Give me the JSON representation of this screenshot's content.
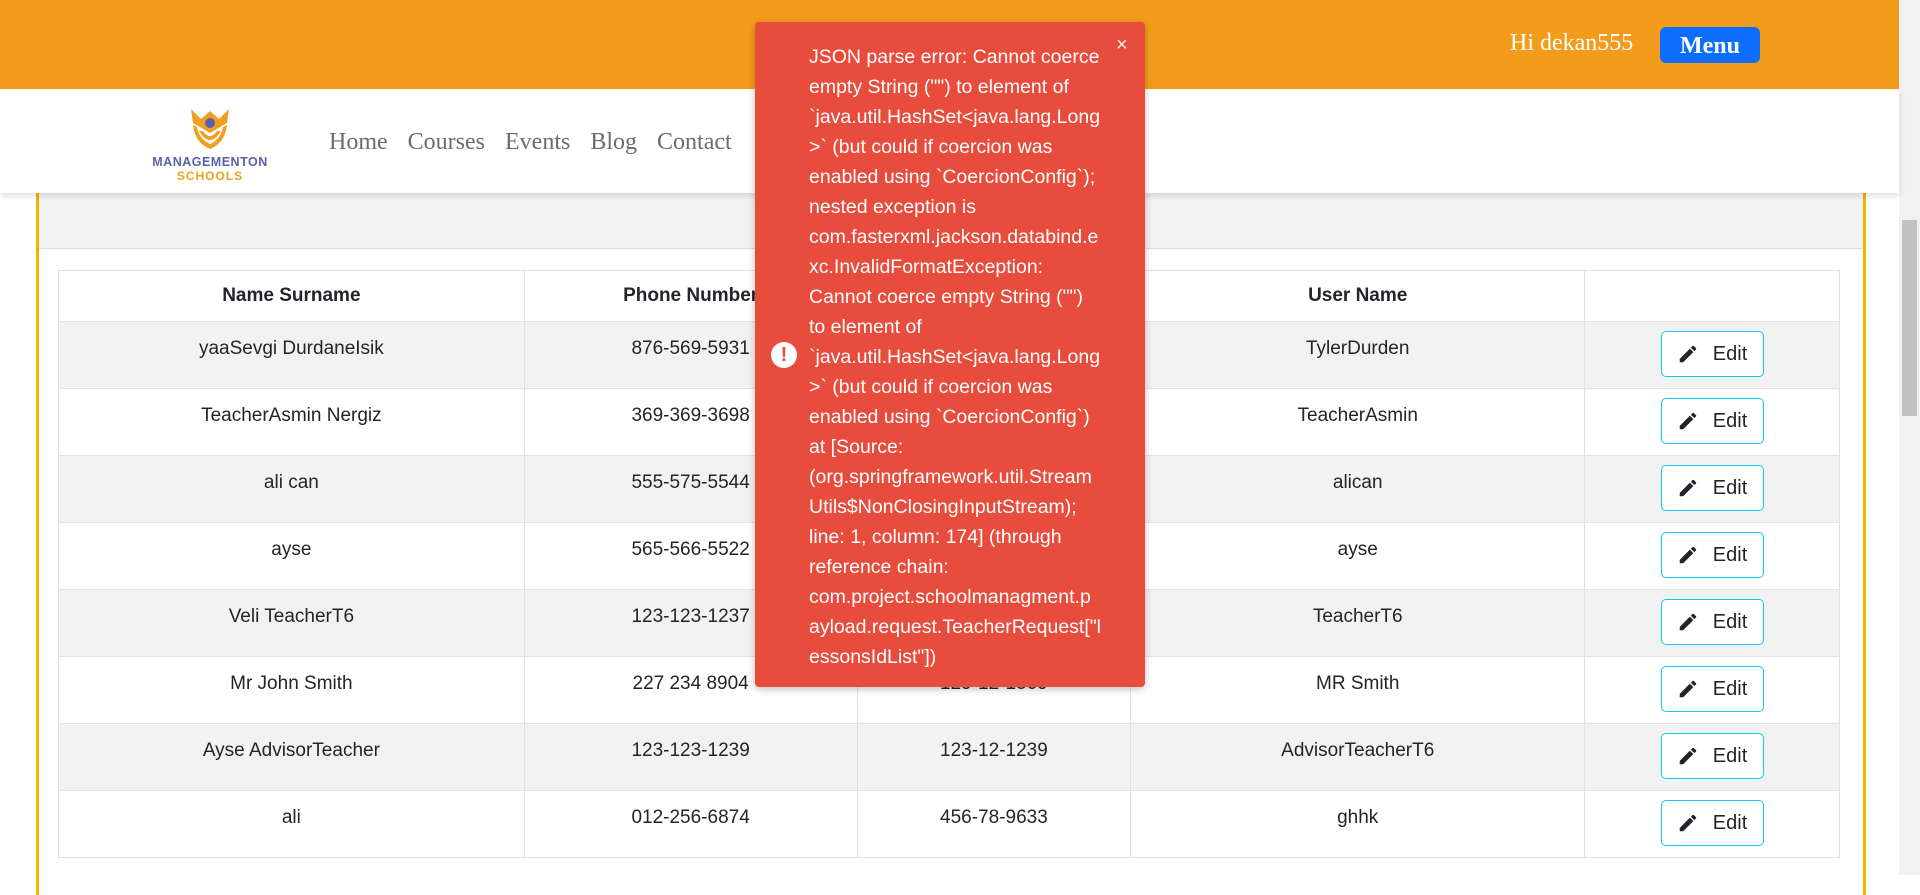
{
  "header": {
    "greeting": "Hi dekan555",
    "menu_label": "Menu"
  },
  "logo": {
    "line1": "MANAGEMENTON",
    "line2": "SCHOOLS"
  },
  "nav": {
    "items": [
      "Home",
      "Courses",
      "Events",
      "Blog",
      "Contact"
    ]
  },
  "table": {
    "columns": [
      "Name Surname",
      "Phone Number",
      "",
      "User Name",
      ""
    ],
    "rows": [
      {
        "name": "yaaSevgi DurdaneIsik",
        "phone": "876-569-5931",
        "ssn": "",
        "username": "TylerDurden"
      },
      {
        "name": "TeacherAsmin Nergiz",
        "phone": "369-369-3698",
        "ssn": "",
        "username": "TeacherAsmin"
      },
      {
        "name": "ali can",
        "phone": "555-575-5544",
        "ssn": "",
        "username": "alican"
      },
      {
        "name": "ayse",
        "phone": "565-566-5522",
        "ssn": "",
        "username": "ayse"
      },
      {
        "name": "Veli TeacherT6",
        "phone": "123-123-1237",
        "ssn": "",
        "username": "TeacherT6"
      },
      {
        "name": "Mr John Smith",
        "phone": "227 234 8904",
        "ssn": "129-12-1569",
        "username": "MR Smith"
      },
      {
        "name": "Ayse AdvisorTeacher",
        "phone": "123-123-1239",
        "ssn": "123-12-1239",
        "username": "AdvisorTeacherT6"
      },
      {
        "name": "ali",
        "phone": "012-256-6874",
        "ssn": "456-78-9633",
        "username": "ghhk"
      }
    ],
    "edit_label": "Edit"
  },
  "toast": {
    "message": "JSON parse error: Cannot coerce\nempty String (\"\") to element of\n`java.util.HashSet<java.lang.Long\n>` (but could if coercion was\nenabled using `CoercionConfig`);\nnested exception is\ncom.fasterxml.jackson.databind.e\nxc.InvalidFormatException:\nCannot coerce empty String (\"\")\nto element of\n`java.util.HashSet<java.lang.Long\n>` (but could if coercion was\nenabled using `CoercionConfig`)\nat [Source:\n(org.springframework.util.Stream\nUtils$NonClosingInputStream);\nline: 1, column: 174] (through\nreference chain:\ncom.project.schoolmanagment.p\nayload.request.TeacherRequest[\"l\nessonsIdList\"])",
    "close_symbol": "×",
    "icon_symbol": "!"
  },
  "colors": {
    "topbar": "#f39c1b",
    "menu_button": "#0d6efd",
    "toast": "#e74c3c",
    "edit_border": "#0dcaf0",
    "frame_border": "#f5b400"
  }
}
